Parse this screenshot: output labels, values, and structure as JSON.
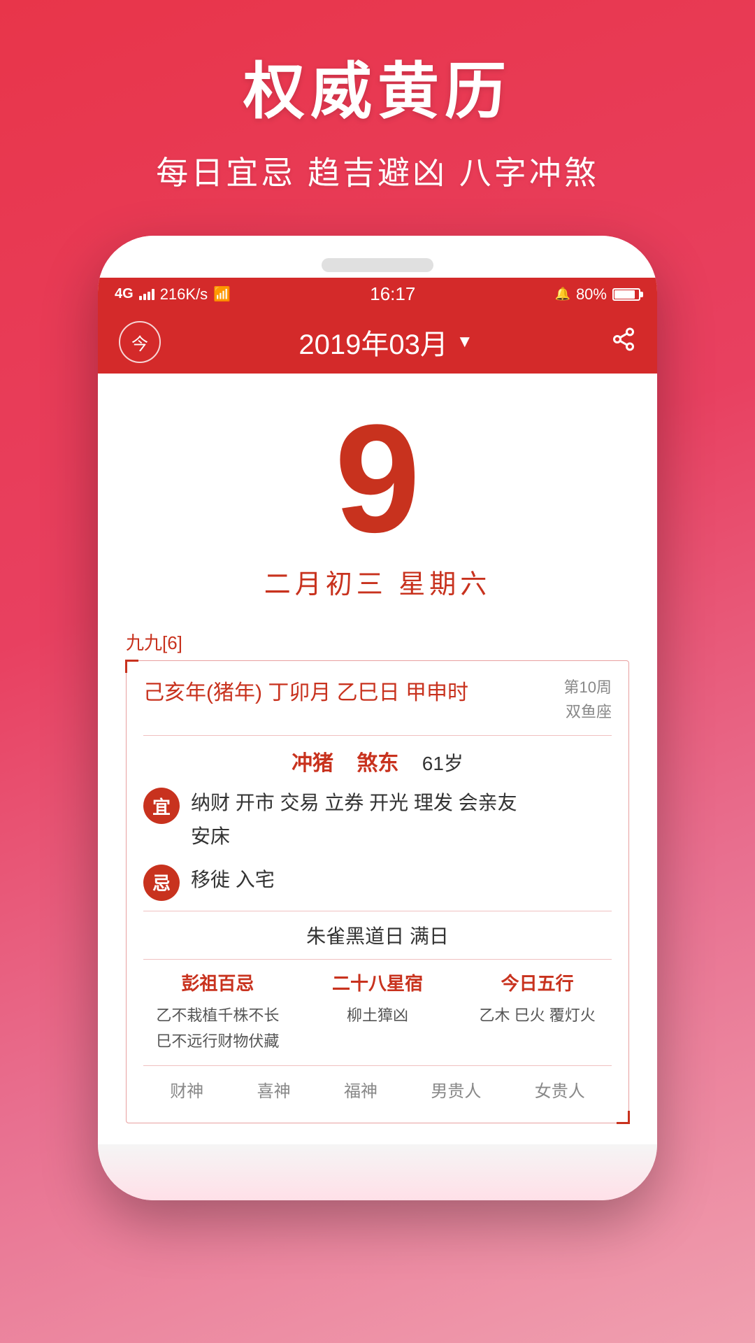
{
  "background": {
    "gradient_start": "#e8354a",
    "gradient_end": "#f0a0b0"
  },
  "top_section": {
    "title": "权威黄历",
    "subtitle": "每日宜忌 趋吉避凶 八字冲煞"
  },
  "phone": {
    "status_bar": {
      "network": "4G",
      "speed": "216K/s",
      "wifi_icon": "wifi",
      "time": "16:17",
      "alarm_icon": "alarm",
      "battery_percent": "80%"
    },
    "header": {
      "today_button_label": "今",
      "month_title": "2019年03月",
      "dropdown_icon": "▼",
      "share_icon": "share"
    },
    "main": {
      "date_number": "9",
      "lunar_date": "二月初三  星期六",
      "nine_nine": "九九[6]",
      "year_info": "己亥年(猪年) 丁卯月 乙巳日 甲申时",
      "week_zodiac_line1": "第10周",
      "week_zodiac_line2": "双鱼座",
      "chong_label": "冲猪",
      "sha_label": "煞东",
      "age": "61岁",
      "yi_label": "宜",
      "yi_text": "纳财 开市 交易 立券 开光 理发 会亲友\n安床",
      "ji_label": "忌",
      "ji_text": "移徙 入宅",
      "special_day": "朱雀黑道日  满日",
      "peng_zu_title": "彭祖百忌",
      "peng_zu_line1": "乙不栽植千株不长",
      "peng_zu_line2": "巳不远行财物伏藏",
      "xiu_title": "二十八星宿",
      "xiu_content": "柳土獐凶",
      "wu_xing_title": "今日五行",
      "wu_xing_content": "乙木 巳火 覆灯火",
      "footer_labels": [
        "财神",
        "喜神",
        "福神",
        "男贵人",
        "女贵人"
      ]
    }
  }
}
